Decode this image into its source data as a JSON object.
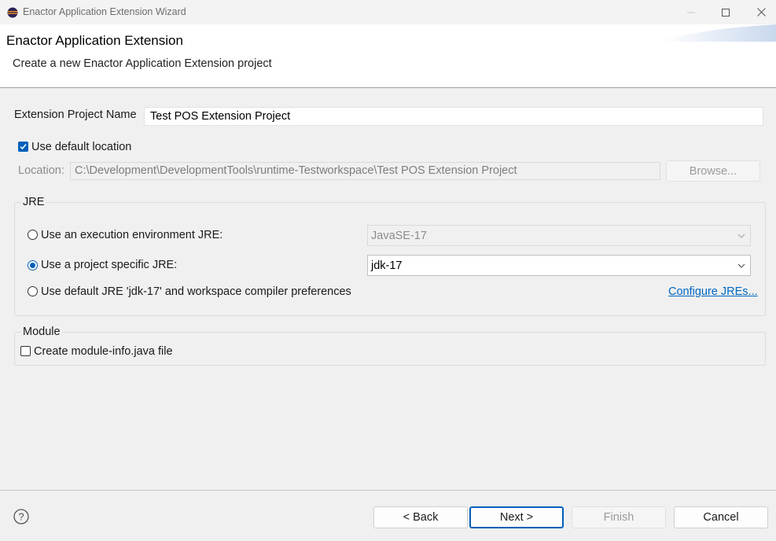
{
  "window": {
    "title": "Enactor Application Extension Wizard",
    "icon": "eclipse-icon",
    "controls": [
      "minimize-icon",
      "maximize-icon",
      "close-icon"
    ]
  },
  "header": {
    "title": "Enactor Application Extension",
    "description": "Create a new Enactor Application Extension project"
  },
  "form": {
    "project_name_label": "Extension Project Name",
    "project_name_value": "Test POS Extension Project",
    "use_default_location_label": "Use default location",
    "use_default_location_checked": true,
    "location_label": "Location:",
    "location_value": "C:\\Development\\DevelopmentTools\\runtime-Testworkspace\\Test POS Extension Project",
    "browse_label": "Browse..."
  },
  "jre": {
    "group_label": "JRE",
    "exec_env_label": "Use an execution environment JRE:",
    "exec_env_value": "JavaSE-17",
    "project_specific_label": "Use a project specific JRE:",
    "project_specific_value": "jdk-17",
    "default_jre_label": "Use default JRE 'jdk-17' and workspace compiler preferences",
    "configure_link": "Configure JREs...",
    "selected": "project_specific"
  },
  "module": {
    "group_label": "Module",
    "create_module_info_label": "Create module-info.java file",
    "create_module_info_checked": false
  },
  "footer": {
    "back_label": "< Back",
    "next_label": "Next >",
    "finish_label": "Finish",
    "cancel_label": "Cancel"
  },
  "colors": {
    "accent": "#005fb8",
    "link": "#0067c0",
    "background": "#f0f0f0"
  }
}
